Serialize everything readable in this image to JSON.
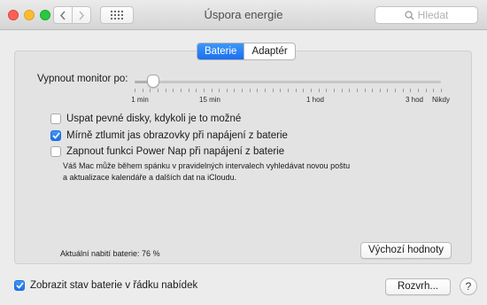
{
  "window": {
    "title": "Úspora energie"
  },
  "search": {
    "placeholder": "Hledat"
  },
  "tabs": [
    {
      "label": "Baterie",
      "selected": true
    },
    {
      "label": "Adaptér",
      "selected": false
    }
  ],
  "slider": {
    "label": "Vypnout monitor po:",
    "value": "2 min",
    "ticks": [
      "1 min",
      "15 min",
      "1 hod",
      "3 hod",
      "Nikdy"
    ]
  },
  "options": [
    {
      "label": "Uspat pevné disky, kdykoli je to možné",
      "checked": false
    },
    {
      "label": "Mírně ztlumit jas obrazovky při napájení z baterie",
      "checked": true
    },
    {
      "label": "Zapnout funkci Power Nap při napájení z baterie",
      "checked": false
    }
  ],
  "power_nap_desc_line1": "Váš Mac může během spánku v pravidelných intervalech vyhledávat novou poštu",
  "power_nap_desc_line2": "a aktualizace kalendáře a dalších dat na iCloudu.",
  "battery": {
    "charge_text": "Aktuální nabití baterie: 76 %"
  },
  "buttons": {
    "defaults": "Výchozí hodnoty",
    "schedule": "Rozvrh...",
    "help": "?"
  },
  "show_status": {
    "label": "Zobrazit stav baterie v řádku nabídek",
    "checked": true
  },
  "colors": {
    "accent": "#1b6ff0",
    "close": "#fc5f57",
    "minimize": "#fdbc2e",
    "maximize": "#28c840"
  }
}
